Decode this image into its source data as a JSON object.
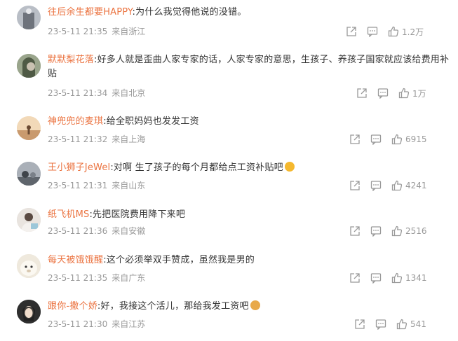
{
  "comments": [
    {
      "username": "往后余生都要HAPPY",
      "text": ":为什么我觉得他说的没错。",
      "time": "23-5-11 21:35",
      "location": "来自浙江",
      "likes": "1.2万",
      "avatar_color": "#c8ccd2"
    },
    {
      "username": "默默梨花落",
      "text": ":好多人就是歪曲人家专家的话，人家专家的意思，生孩子、养孩子国家就应该给费用补贴",
      "time": "23-5-11 21:34",
      "location": "来自北京",
      "likes": "1万",
      "avatar_color": "#7a8b6e"
    },
    {
      "username": "神兜兜的麦琪",
      "text": ":给全职妈妈也发发工资",
      "time": "23-5-11 21:32",
      "location": "来自上海",
      "likes": "6915",
      "avatar_color": "#e8c9a0"
    },
    {
      "username": "王小狮子JeWel",
      "text": ":对啊 生了孩子的每个月都给点工资补贴吧",
      "time": "23-5-11 21:31",
      "location": "来自山东",
      "likes": "4241",
      "avatar_color": "#8a9098"
    },
    {
      "username": "纸飞机MS",
      "text": ":先把医院费用降下来吧",
      "time": "23-5-11 21:36",
      "location": "来自安徽",
      "likes": "2516",
      "avatar_color": "#d9d2cc"
    },
    {
      "username": "每天被饿饿醒",
      "text": ":这个必须举双手赞成，虽然我是男的",
      "time": "23-5-11 21:35",
      "location": "来自广东",
      "likes": "1341",
      "avatar_color": "#e3ddd0"
    },
    {
      "username": "跟你-撒个娇",
      "text": ":好，我接这个活儿，那给我发工资吧",
      "time": "23-5-11 21:30",
      "location": "来自江苏",
      "likes": "541",
      "avatar_color": "#3a3a3a"
    }
  ],
  "icons": {
    "share": "share-icon",
    "comment": "comment-icon",
    "like": "like-icon"
  },
  "colors": {
    "username": "#eb7340",
    "text": "#333333",
    "meta": "#999999"
  }
}
